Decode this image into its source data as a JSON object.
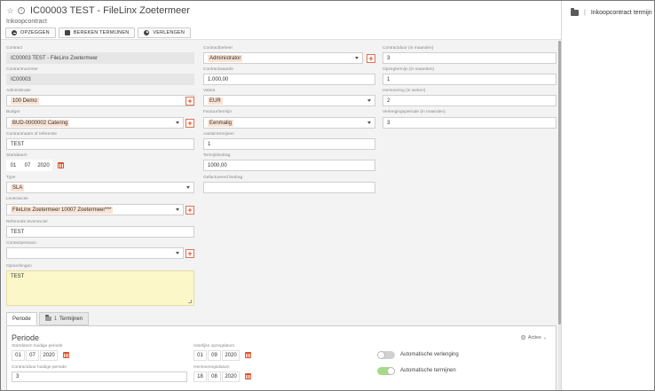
{
  "header": {
    "title": "IC00003 TEST - FileLinx Zoetermeer",
    "subtitle": "Inkoopcontract"
  },
  "toolbar": {
    "opzeggen": "OPZEGGEN",
    "bereken": "BEREKEN TERMIJNEN",
    "verlengen": "VERLENGEN"
  },
  "right_panel": {
    "title": "Inkoopcontract termijn"
  },
  "col1": {
    "contract": {
      "label": "Contract",
      "value": "IC00003 TEST - FileLinx Zoetermeer"
    },
    "contractnummer": {
      "label": "Contractnummer",
      "value": "IC00003"
    },
    "administratie": {
      "label": "Administratie",
      "value": "100 Demo"
    },
    "budget": {
      "label": "Budget",
      "value": "BUD-0000002 Catering"
    },
    "contractnaam": {
      "label": "Contractnaam of referentie",
      "value": "TEST"
    },
    "startdatum": {
      "label": "Startdatum",
      "day": "01",
      "month": "07",
      "year": "2020"
    },
    "type": {
      "label": "Type",
      "value": "SLA"
    },
    "leverancier": {
      "label": "Leverancier",
      "value": "FileLinx Zoetermeer 10007 Zoetermeer***"
    },
    "referentie_leverancier": {
      "label": "Referentie leverancier",
      "value": "TEST"
    },
    "contactpersoon": {
      "label": "Contactpersoon",
      "value": ""
    },
    "opmerkingen": {
      "label": "Opmerkingen",
      "value": "TEST"
    }
  },
  "col2": {
    "contractbeheer": {
      "label": "Contractbeheer",
      "value": "Administrator"
    },
    "contractwaarde": {
      "label": "Contractwaarde",
      "value": "1.000,00"
    },
    "valuta": {
      "label": "Valuta",
      "value": "EUR"
    },
    "factuurtermijn": {
      "label": "Factuur/termijn",
      "value": "Eenmalig"
    },
    "aantal_termijnen": {
      "label": "Aantal termijnen",
      "value": "1"
    },
    "termijnbedrag": {
      "label": "Termijnbedrag",
      "value": "1000,00"
    },
    "gefactureerd": {
      "label": "Gefactureerd bedrag",
      "value": ""
    }
  },
  "col3": {
    "contractduur": {
      "label": "Contractduur (in maanden)",
      "value": "3"
    },
    "opzegtermijn": {
      "label": "Opzegtermijn (in maanden)",
      "value": "1"
    },
    "herinnering": {
      "label": "Herinnering (in weken)",
      "value": "2"
    },
    "verlengingsperiode": {
      "label": "Verlengingsperiode (in maanden)",
      "value": "3"
    }
  },
  "tabs": [
    {
      "label": "Periode"
    },
    {
      "label": "Termijnen",
      "badge": "1"
    }
  ],
  "periode": {
    "title": "Periode",
    "acties": "Acties",
    "startdatum": {
      "label": "Startdatum huidige periode",
      "day": "01",
      "month": "07",
      "year": "2020"
    },
    "contractduur": {
      "label": "Contractduur huidige periode",
      "value": "3"
    },
    "opzegdatum": {
      "label": "Uiterlijke opzegdatum",
      "day": "01",
      "month": "09",
      "year": "2020"
    },
    "herinneringsdatum": {
      "label": "Herinneringsdatum",
      "day": "18",
      "month": "08",
      "year": "2020"
    },
    "automatische_verlenging": {
      "label": "Automatische verlenging",
      "on": false
    },
    "automatische_termijnen": {
      "label": "Automatische termijnen",
      "on": true
    }
  },
  "colors": {
    "accent": "#d9532c",
    "chip": "#fbe3d4",
    "toggle_on": "#a6d98a",
    "note": "#fbf7c8"
  }
}
